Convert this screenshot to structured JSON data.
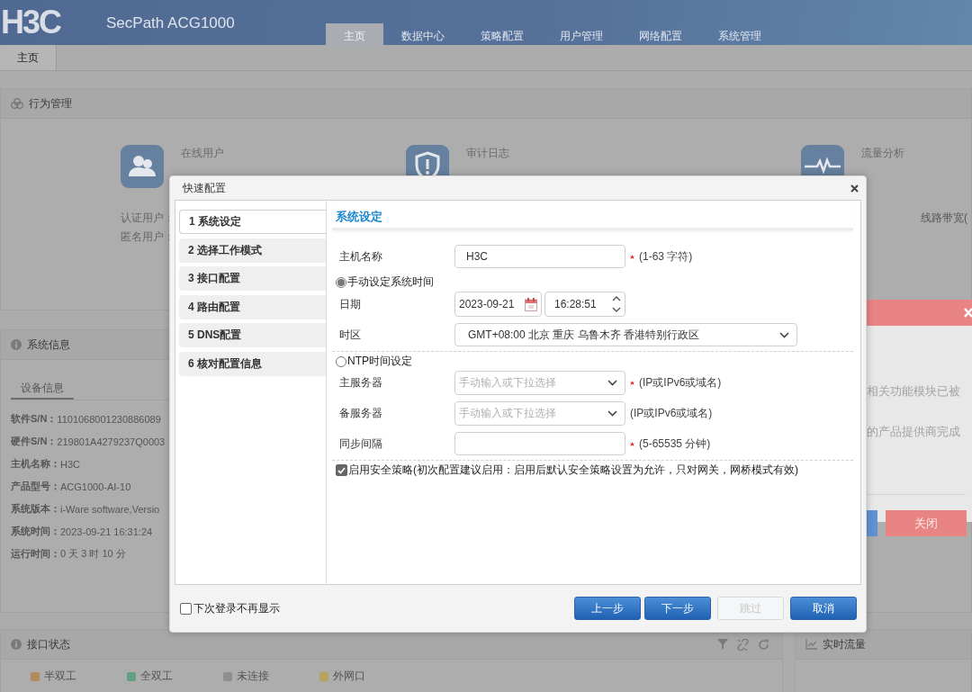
{
  "header": {
    "logo": "H3C",
    "product": "SecPath ACG1000",
    "nav": [
      {
        "label": "主页",
        "selected": true
      },
      {
        "label": "数据中心",
        "selected": false
      },
      {
        "label": "策略配置",
        "selected": false
      },
      {
        "label": "用户管理",
        "selected": false
      },
      {
        "label": "网络配置",
        "selected": false
      },
      {
        "label": "系统管理",
        "selected": false
      }
    ]
  },
  "page_tabs": [
    {
      "label": "主页",
      "selected": true
    }
  ],
  "behavior_panel": {
    "title": "行为管理",
    "stats": [
      {
        "kind": "users",
        "label": "在线用户"
      },
      {
        "kind": "shield",
        "label": "审计日志"
      },
      {
        "kind": "pulse",
        "label": "流量分析"
      }
    ],
    "user_lines": [
      "认证用户：",
      "匿名用户："
    ],
    "column_3": "线路带宽("
  },
  "sysinfo_panel": {
    "title": "系统信息",
    "tab": "设备信息",
    "rows": [
      {
        "label": "软件S/N：",
        "value": "1101068001230886089"
      },
      {
        "label": "硬件S/N：",
        "value": "219801A4279237Q0003"
      },
      {
        "label": "主机名称：",
        "value": "H3C"
      },
      {
        "label": "产品型号：",
        "value": "ACG1000-AI-10"
      },
      {
        "label": "系统版本：",
        "value": "i-Ware software,Versio"
      },
      {
        "label": "系统时间：",
        "value": "2023-09-21 16:31:24"
      },
      {
        "label": "运行时间：",
        "value": "0 天 3 时 10 分"
      }
    ]
  },
  "interface_panel": {
    "title": "接口状态",
    "legend": [
      {
        "label": "半双工",
        "color": "#b08a5e"
      },
      {
        "label": "全双工",
        "color": "#5fa283"
      },
      {
        "label": "未连接",
        "color": "#8e8e8e"
      },
      {
        "label": "外网口",
        "color": "#b8a45e"
      }
    ]
  },
  "realtime_panel": {
    "title": "实时流量"
  },
  "notice": {
    "lines": [
      "相关功能模块已被",
      "的产品提供商完成"
    ],
    "button": "关闭"
  },
  "dialog": {
    "title": "快速配置",
    "steps": [
      {
        "label": "1 系统设定",
        "selected": true
      },
      {
        "label": "2 选择工作模式",
        "selected": false
      },
      {
        "label": "3 接口配置",
        "selected": false
      },
      {
        "label": "4 路由配置",
        "selected": false
      },
      {
        "label": "5 DNS配置",
        "selected": false
      },
      {
        "label": "6 核对配置信息",
        "selected": false
      }
    ],
    "section_title": "系统设定",
    "groups": [
      [
        {
          "kind": "text",
          "label": "主机名称",
          "value": "H3C",
          "required": true,
          "hint": "(1-63 字符)"
        },
        {
          "kind": "radio",
          "label": "手动设定系统时间",
          "selected": true
        },
        {
          "kind": "datetime",
          "label": "日期",
          "date": "2023-09-21",
          "time": "16:28:51"
        },
        {
          "kind": "select",
          "label": "时区",
          "value": "GMT+08:00 北京 重庆 乌鲁木齐 香港特别行政区"
        }
      ],
      [
        {
          "kind": "radio",
          "label": "NTP时间设定",
          "selected": false
        },
        {
          "kind": "combo",
          "label": "主服务器",
          "placeholder": "手动输入或下拉选择",
          "required": true,
          "hint": "(IP或IPv6或域名)"
        },
        {
          "kind": "combo",
          "label": "备服务器",
          "placeholder": "手动输入或下拉选择",
          "required": false,
          "hint": "(IP或IPv6或域名)"
        },
        {
          "kind": "text",
          "label": "同步间隔",
          "required": true,
          "hint": "(5-65535 分钟)"
        }
      ],
      [
        {
          "kind": "checkbox",
          "label": "启用安全策略(初次配置建议启用：启用后默认安全策略设置为允许，只对网关，网桥模式有效)",
          "checked": true
        }
      ]
    ],
    "footer": {
      "checkbox": {
        "label": "下次登录不再显示",
        "checked": false
      },
      "buttons": [
        {
          "label": "上一步",
          "disabled": false
        },
        {
          "label": "下一步",
          "disabled": false
        },
        {
          "label": "跳过",
          "disabled": true
        },
        {
          "label": "取消",
          "disabled": false
        }
      ]
    }
  }
}
